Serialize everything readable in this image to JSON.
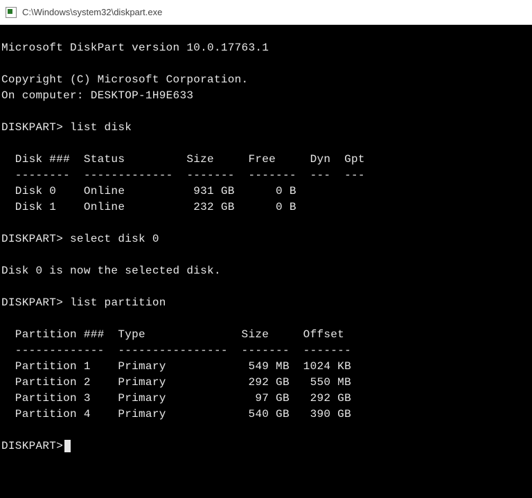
{
  "window": {
    "title": "C:\\Windows\\system32\\diskpart.exe"
  },
  "header": {
    "version_line": "Microsoft DiskPart version 10.0.17763.1",
    "copyright": "Copyright (C) Microsoft Corporation.",
    "computer_line": "On computer: DESKTOP-1H9E633"
  },
  "prompt": "DISKPART>",
  "commands": {
    "c1": "list disk",
    "c2": "select disk 0",
    "c3": "list partition"
  },
  "list_disk": {
    "header": "  Disk ###  Status         Size     Free     Dyn  Gpt",
    "divider": "  --------  -------------  -------  -------  ---  ---",
    "rows": [
      "  Disk 0    Online          931 GB      0 B",
      "  Disk 1    Online          232 GB      0 B"
    ]
  },
  "select_response": "Disk 0 is now the selected disk.",
  "list_partition": {
    "header": "  Partition ###  Type              Size     Offset",
    "divider": "  -------------  ----------------  -------  -------",
    "rows": [
      "  Partition 1    Primary            549 MB  1024 KB",
      "  Partition 2    Primary            292 GB   550 MB",
      "  Partition 3    Primary             97 GB   292 GB",
      "  Partition 4    Primary            540 GB   390 GB"
    ]
  }
}
